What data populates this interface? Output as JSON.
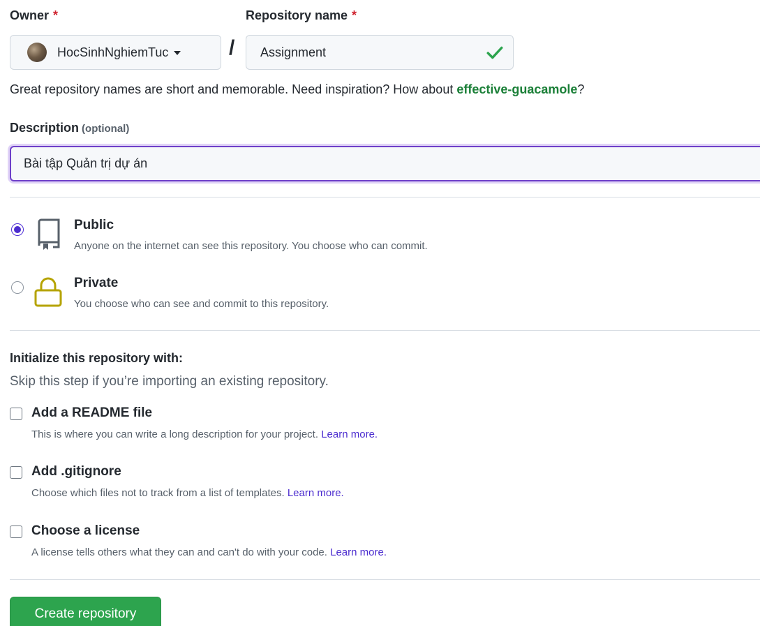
{
  "owner": {
    "label": "Owner",
    "required_mark": "*",
    "value": "HocSinhNghiemTuc"
  },
  "separator": "/",
  "repo": {
    "label": "Repository name",
    "required_mark": "*",
    "value": "Assignment",
    "valid_icon": "check-icon"
  },
  "hint": {
    "text": "Great repository names are short and memorable. Need inspiration? How about ",
    "suggestion": "effective-guacamole",
    "end": "?"
  },
  "description": {
    "label": "Description",
    "optional": "(optional)",
    "value": "Bài tập Quản trị dự án"
  },
  "visibility": {
    "public": {
      "title": "Public",
      "desc": "Anyone on the internet can see this repository. You choose who can commit.",
      "selected": true,
      "icon": "repo-icon"
    },
    "private": {
      "title": "Private",
      "desc": "You choose who can see and commit to this repository.",
      "selected": false,
      "icon": "lock-icon"
    }
  },
  "init": {
    "title": "Initialize this repository with:",
    "subtitle": "Skip this step if you’re importing an existing repository.",
    "options": [
      {
        "title": "Add a README file",
        "desc": "This is where you can write a long description for your project. ",
        "link": "Learn more.",
        "checked": false
      },
      {
        "title": "Add .gitignore",
        "desc": "Choose which files not to track from a list of templates. ",
        "link": "Learn more.",
        "checked": false
      },
      {
        "title": "Choose a license",
        "desc": "A license tells others what they can and can't do with your code. ",
        "link": "Learn more.",
        "checked": false
      }
    ]
  },
  "create_button": "Create repository",
  "colors": {
    "accent_green": "#2da44e",
    "link_purple": "#4b2ccf",
    "required_red": "#cf222e",
    "lock_yellow": "#b5a300"
  }
}
